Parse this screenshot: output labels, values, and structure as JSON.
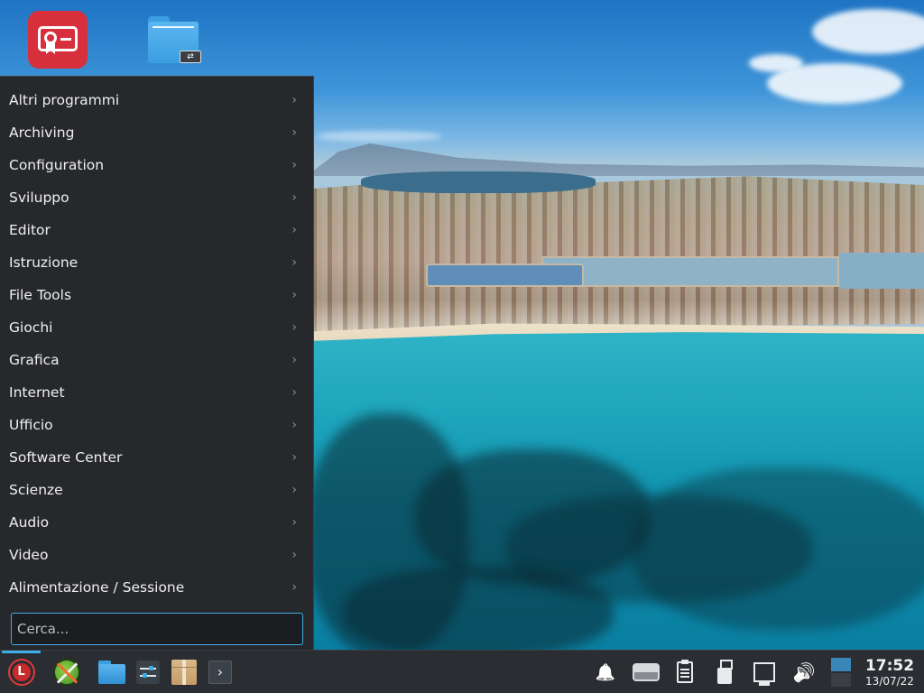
{
  "desktop": {
    "icons": [
      {
        "name": "certificate-app-icon"
      },
      {
        "name": "folder-mount-icon",
        "badge": "⇄"
      }
    ]
  },
  "menu": {
    "items": [
      {
        "label": "Altri programmi"
      },
      {
        "label": "Archiving"
      },
      {
        "label": "Configuration"
      },
      {
        "label": "Sviluppo"
      },
      {
        "label": "Editor"
      },
      {
        "label": "Istruzione"
      },
      {
        "label": "File Tools"
      },
      {
        "label": "Giochi"
      },
      {
        "label": "Grafica"
      },
      {
        "label": "Internet"
      },
      {
        "label": "Ufficio"
      },
      {
        "label": "Software Center"
      },
      {
        "label": "Scienze"
      },
      {
        "label": "Audio"
      },
      {
        "label": "Video"
      },
      {
        "label": "Alimentazione / Sessione"
      }
    ],
    "submenu_glyph": "›",
    "search": {
      "placeholder": "Cerca...",
      "value": ""
    }
  },
  "taskbar": {
    "launcher_glyph": "L",
    "terminal_glyph": "›",
    "tray": {
      "bell_glyph": "🔔",
      "volume_glyph": "🔊"
    },
    "clock": {
      "time": "17:52",
      "date": "13/07/22"
    }
  },
  "colors": {
    "accent": "#3daee9",
    "menu_bg": "#26282c",
    "taskbar_bg": "#2a2d31",
    "launcher_red": "#e23a3a"
  }
}
